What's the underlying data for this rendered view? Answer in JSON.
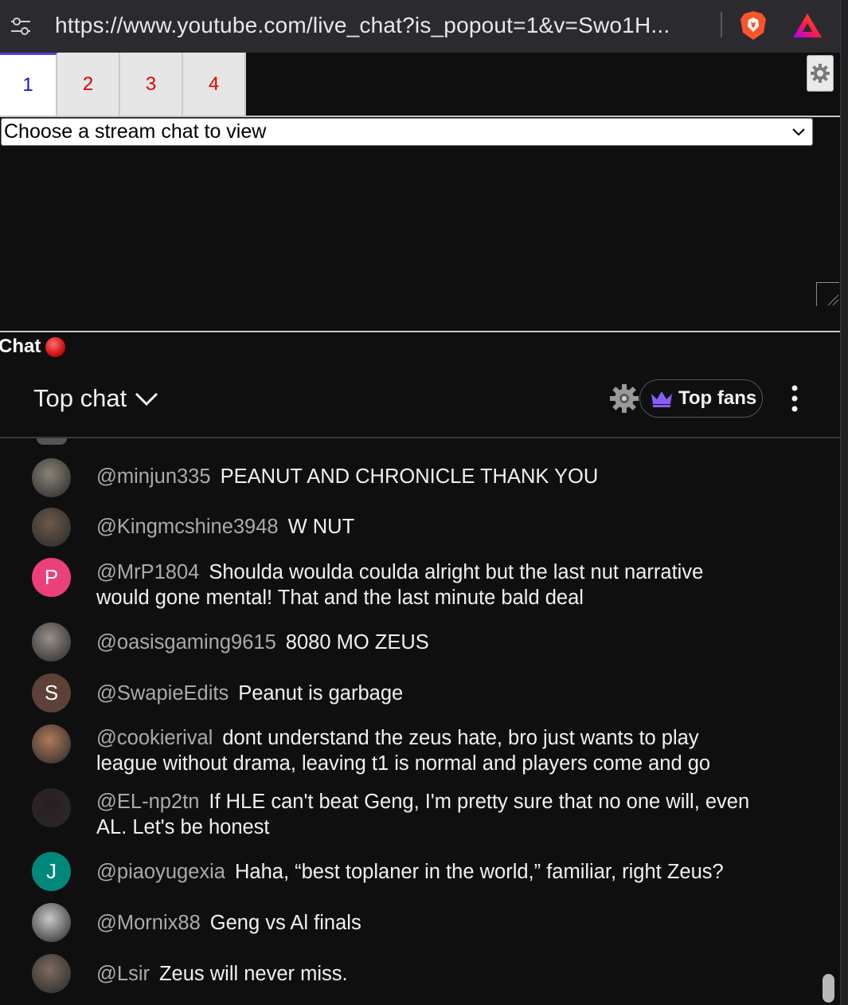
{
  "browser": {
    "url": "https://www.youtube.com/live_chat?is_popout=1&v=Swo1H..."
  },
  "tabs": [
    {
      "label": "1",
      "active": true
    },
    {
      "label": "2",
      "active": false
    },
    {
      "label": "3",
      "active": false
    },
    {
      "label": "4",
      "active": false
    }
  ],
  "stream_select": {
    "selected": "Choose a stream chat to view"
  },
  "chat_section": {
    "label": "Chat"
  },
  "chat_header": {
    "mode": "Top chat",
    "top_fans_label": "Top fans"
  },
  "colors": {
    "accent_tab": "#5b3ad8",
    "active_tab_text": "#1515d4",
    "inactive_tab_text": "#e00000",
    "crown": "#8a5cf6",
    "author_text": "#aaaaaa"
  },
  "messages": [
    {
      "author": "@minjun335",
      "text": "PEANUT AND CHRONICLE THANK YOU",
      "avatar_letter": "",
      "avatar_color": "#8b8377"
    },
    {
      "author": "@Kingmcshine3948",
      "text": "W NUT",
      "avatar_letter": "",
      "avatar_color": "#6e5a4a"
    },
    {
      "author": "@MrP1804",
      "text": "Shoulda woulda coulda alright but the last nut narrative would gone mental! That and the last minute bald deal",
      "avatar_letter": "P",
      "avatar_color": "#ec407a"
    },
    {
      "author": "@oasisgaming9615",
      "text": "8080 MO ZEUS",
      "avatar_letter": "",
      "avatar_color": "#9a8f88"
    },
    {
      "author": "@SwapieEdits",
      "text": "Peanut is garbage",
      "avatar_letter": "S",
      "avatar_color": "#5d4037"
    },
    {
      "author": "@cookierival",
      "text": "dont understand the zeus hate, bro just wants to play league without drama, leaving t1 is normal and players come and go",
      "avatar_letter": "",
      "avatar_color": "#b07a5a"
    },
    {
      "author": "@EL-np2tn",
      "text": "If HLE can't beat Geng, I'm pretty sure that no one will, even AL. Let's be honest",
      "avatar_letter": "",
      "avatar_color": "#2a1d24"
    },
    {
      "author": "@piaoyugexia",
      "text": "Haha, “best toplaner in the world,” familiar, right Zeus?",
      "avatar_letter": "J",
      "avatar_color": "#00897b"
    },
    {
      "author": "@Mornix88",
      "text": "Geng vs Al finals",
      "avatar_letter": "",
      "avatar_color": "#c9c9c9"
    },
    {
      "author": "@Lsir",
      "text": "Zeus will never miss.",
      "avatar_letter": "",
      "avatar_color": "#7d6b60"
    }
  ]
}
